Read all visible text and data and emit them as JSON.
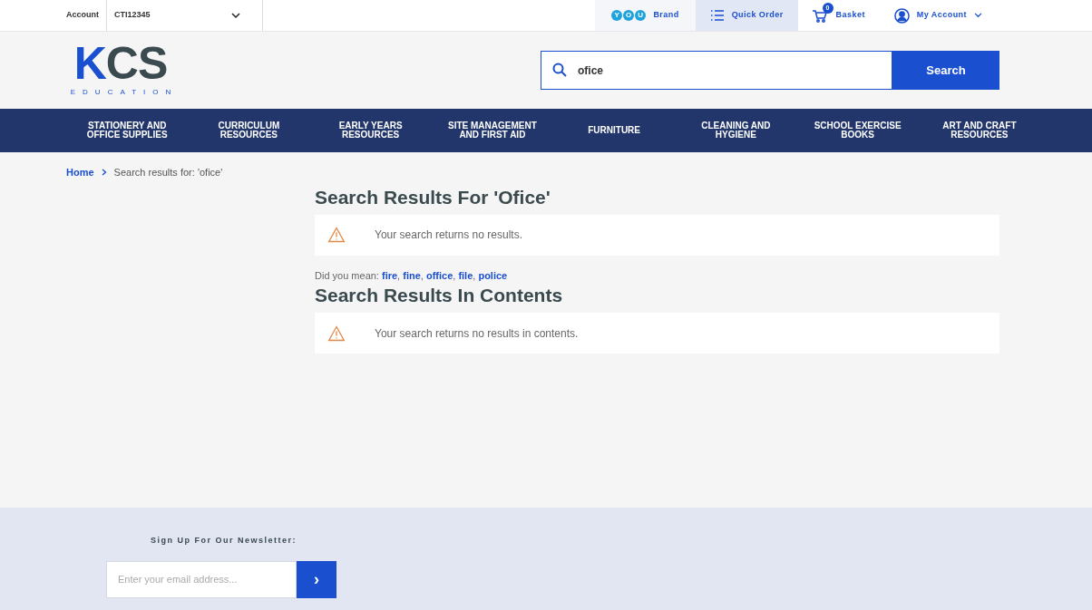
{
  "top_bar": {
    "account_label": "Account",
    "account_value": "CTI12345",
    "links": [
      {
        "kind": "brand",
        "badge_letters": [
          "Y",
          "O",
          "U"
        ],
        "label": "Brand",
        "selected": false
      },
      {
        "kind": "quick_order",
        "label": "Quick Order",
        "selected": true
      },
      {
        "kind": "basket",
        "label": "Basket",
        "count": "0",
        "selected": false
      },
      {
        "kind": "account",
        "label": "My Account",
        "selected": false
      }
    ]
  },
  "header": {
    "logo": {
      "mark": "KCS",
      "subtitle": "EDUCATION"
    },
    "search": {
      "value": "ofice",
      "button": "Search"
    }
  },
  "nav": [
    "STATIONERY AND OFFICE SUPPLIES",
    "CURRICULUM RESOURCES",
    "EARLY YEARS RESOURCES",
    "SITE MANAGEMENT AND FIRST AID",
    "FURNITURE",
    "CLEANING AND HYGIENE",
    "SCHOOL EXERCISE BOOKS",
    "ART AND CRAFT RESOURCES"
  ],
  "breadcrumb": [
    {
      "label": "Home",
      "link": true
    },
    {
      "label": "Search results for: 'ofice'",
      "link": false
    }
  ],
  "results": {
    "title": "Search Results For 'Ofice'",
    "message": "Your search returns no results.",
    "did_you_mean_label": "Did you mean:",
    "suggestion_separator": ",",
    "suggestions": [
      "fire",
      "fine",
      "office",
      "file",
      "police"
    ]
  },
  "contents": {
    "title": "Search Results In Contents",
    "message": "Your search returns no results in contents."
  },
  "newsletter": {
    "title": "Sign Up For Our Newsletter:",
    "placeholder": "Enter your email address...",
    "button": "›"
  }
}
